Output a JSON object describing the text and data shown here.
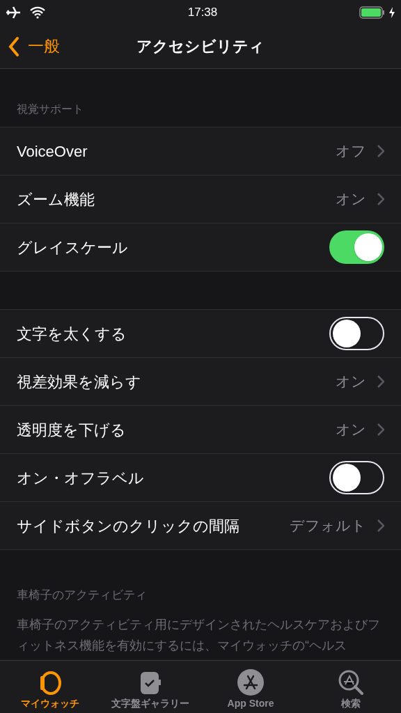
{
  "status_bar": {
    "time": "17:38"
  },
  "nav": {
    "back": "一般",
    "title": "アクセシビリティ"
  },
  "sections": [
    {
      "header": "視覚サポート",
      "rows": [
        {
          "kind": "value",
          "label": "VoiceOver",
          "value": "オフ"
        },
        {
          "kind": "value",
          "label": "ズーム機能",
          "value": "オン"
        },
        {
          "kind": "toggle",
          "label": "グレイスケール",
          "on": true
        }
      ]
    },
    {
      "rows": [
        {
          "kind": "toggle",
          "label": "文字を太くする",
          "on": false
        },
        {
          "kind": "value",
          "label": "視差効果を減らす",
          "value": "オン"
        },
        {
          "kind": "value",
          "label": "透明度を下げる",
          "value": "オン"
        },
        {
          "kind": "toggle",
          "label": "オン・オフラベル",
          "on": false
        },
        {
          "kind": "value",
          "label": "サイドボタンのクリックの間隔",
          "value": "デフォルト"
        }
      ]
    }
  ],
  "footer": {
    "header": "車椅子のアクティビティ",
    "text": "車椅子のアクティビティ用にデザインされたヘルスケアおよびフィットネス機能を有効にするには、マイウォッチの“ヘルス"
  },
  "tabs": [
    {
      "kind": "watch",
      "label": "マイウォッチ",
      "selected": true
    },
    {
      "kind": "gallery",
      "label": "文字盤ギャラリー",
      "selected": false
    },
    {
      "kind": "store",
      "label": "App Store",
      "selected": false
    },
    {
      "kind": "search",
      "label": "検索",
      "selected": false
    }
  ]
}
